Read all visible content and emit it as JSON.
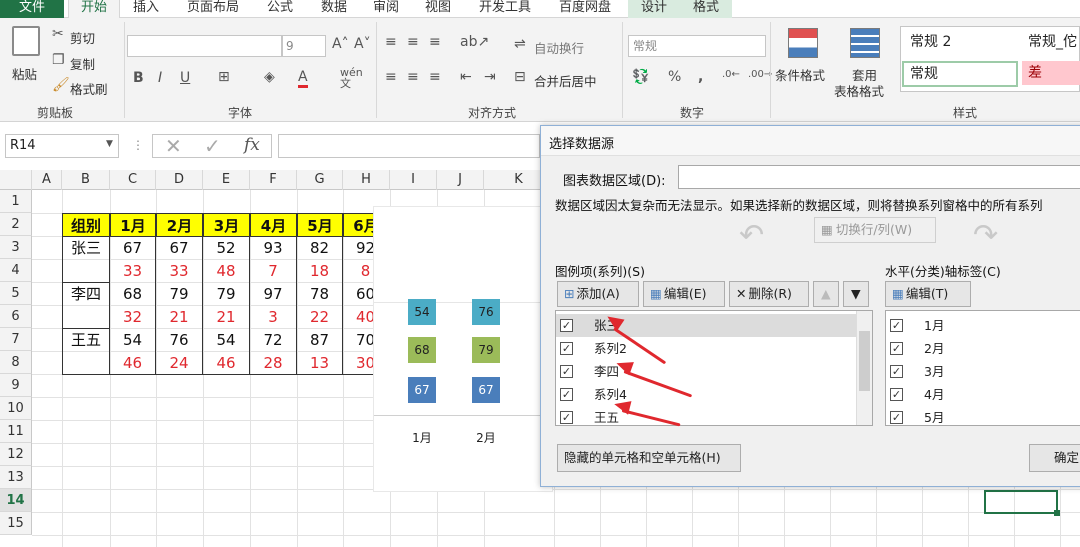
{
  "tabs": [
    "文件",
    "开始",
    "插入",
    "页面布局",
    "公式",
    "数据",
    "审阅",
    "视图",
    "开发工具",
    "百度网盘",
    "设计",
    "格式"
  ],
  "ribbon": {
    "paste": "粘贴",
    "cut": "剪切",
    "copy": "复制",
    "format_painter": "格式刷",
    "clipboard": "剪贴板",
    "font_size": "9",
    "font_group": "字体",
    "bold": "B",
    "italic": "I",
    "underline": "U",
    "wrap_text": "自动换行",
    "merge_center": "合并后居中",
    "align_group": "对齐方式",
    "number_format": "常规",
    "percent": "%",
    "comma": ",",
    "number_group": "数字",
    "cond_format": "条件格式",
    "table_format_1": "套用",
    "table_format_2": "表格格式",
    "styles_group": "样式",
    "style_normal2": "常规 2",
    "style_normal_cut": "常规_佗",
    "style_normal": "常规",
    "style_bad": "差"
  },
  "formula_bar": {
    "name_box": "R14",
    "fx": "fx"
  },
  "columns": [
    "A",
    "B",
    "C",
    "D",
    "E",
    "F",
    "G",
    "H",
    "I",
    "J",
    "K"
  ],
  "rows": [
    "1",
    "2",
    "3",
    "4",
    "5",
    "6",
    "7",
    "8",
    "9",
    "10",
    "11",
    "12",
    "13",
    "14",
    "15"
  ],
  "table": {
    "header": [
      "组别",
      "1月",
      "2月",
      "3月",
      "4月",
      "5月",
      "6月"
    ],
    "rows": [
      {
        "name": "张三",
        "values": [
          "67",
          "67",
          "52",
          "93",
          "82",
          "92"
        ],
        "red": false
      },
      {
        "name": "",
        "values": [
          "33",
          "33",
          "48",
          "7",
          "18",
          "8"
        ],
        "red": true
      },
      {
        "name": "李四",
        "values": [
          "68",
          "79",
          "79",
          "97",
          "78",
          "60"
        ],
        "red": false
      },
      {
        "name": "",
        "values": [
          "32",
          "21",
          "21",
          "3",
          "22",
          "40"
        ],
        "red": true
      },
      {
        "name": "王五",
        "values": [
          "54",
          "76",
          "54",
          "72",
          "87",
          "70"
        ],
        "red": false
      },
      {
        "name": "",
        "values": [
          "46",
          "24",
          "46",
          "28",
          "13",
          "30"
        ],
        "red": true
      }
    ]
  },
  "chart_data": {
    "type": "bar",
    "categories": [
      "1月",
      "2月"
    ],
    "series": [
      {
        "values": [
          67,
          67
        ],
        "color": "#4a7ebb"
      },
      {
        "values": [
          68,
          79
        ],
        "color": "#9bbb59"
      },
      {
        "values": [
          54,
          76
        ],
        "color": "#4bacc6"
      }
    ]
  },
  "dialog": {
    "title": "选择数据源",
    "range_label": "图表数据区域(D):",
    "info": "数据区域因太复杂而无法显示。如果选择新的数据区域，则将替换系列窗格中的所有系列",
    "switch": "切换行/列(W)",
    "legend_label": "图例项(系列)(S)",
    "axis_label": "水平(分类)轴标签(C)",
    "add": "添加(A)",
    "edit": "编辑(E)",
    "delete": "删除(R)",
    "axis_edit": "编辑(T)",
    "series_items": [
      "张三",
      "系列2",
      "李四",
      "系列4",
      "王五"
    ],
    "axis_items": [
      "1月",
      "2月",
      "3月",
      "4月",
      "5月"
    ],
    "hidden_cells": "隐藏的单元格和空单元格(H)",
    "ok": "确定"
  },
  "colors": {
    "excel_green": "#217346",
    "highlight": "#ffff00",
    "red_text": "#e0282e",
    "annotation": "#e0282e"
  }
}
